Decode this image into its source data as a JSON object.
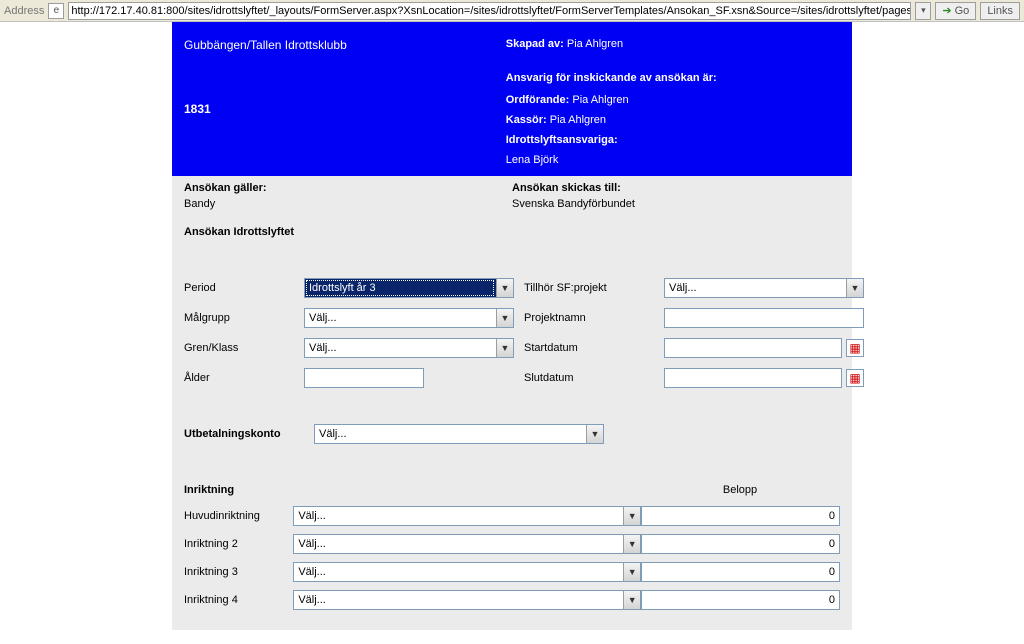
{
  "browser": {
    "address_label": "Address",
    "url": "http://172.17.40.81:800/sites/idrottslyftet/_layouts/FormServer.aspx?XsnLocation=/sites/idrottslyftet/FormServerTemplates/Ansokan_SF.xsn&Source=/sites/idrottslyftet/pages/",
    "go_label": "Go",
    "links_label": "Links",
    "favicon_glyph": "e"
  },
  "header": {
    "club_name": "Gubbängen/Tallen Idrottsklubb",
    "club_number": "1831",
    "skapad_av_label": "Skapad av:",
    "skapad_av": "Pia Ahlgren",
    "ansvarig_title": "Ansvarig för inskickande av ansökan är:",
    "ordforande_label": "Ordförande:",
    "ordforande": "Pia Ahlgren",
    "kassor_label": "Kassör:",
    "kassor": "Pia Ahlgren",
    "ansvariga_label": "Idrottslyftsansvariga:",
    "ansvariga": "Lena Björk"
  },
  "meta": {
    "ansokan_galler_label": "Ansökan gäller:",
    "ansokan_galler_value": "Bandy",
    "skickas_till_label": "Ansökan skickas till:",
    "skickas_till_value": "Svenska Bandyförbundet",
    "ansokan_title": "Ansökan Idrottslyftet"
  },
  "form": {
    "period_label": "Period",
    "period_value": "Idrottslyft år 3",
    "malgrupp_label": "Målgrupp",
    "malgrupp_value": "Välj...",
    "gren_label": "Gren/Klass",
    "gren_value": "Välj...",
    "alder_label": "Ålder",
    "alder_value": "",
    "sfprojekt_label": "Tillhör SF:projekt",
    "sfprojekt_value": "Välj...",
    "projektnamn_label": "Projektnamn",
    "projektnamn_value": "",
    "startdatum_label": "Startdatum",
    "startdatum_value": "",
    "slutdatum_label": "Slutdatum",
    "slutdatum_value": ""
  },
  "utbet": {
    "label": "Utbetalningskonto",
    "value": "Välj..."
  },
  "inriktning": {
    "heading": "Inriktning",
    "belopp_heading": "Belopp",
    "rows": [
      {
        "label": "Huvudinriktning",
        "value": "Välj...",
        "amount": "0"
      },
      {
        "label": "Inriktning 2",
        "value": "Välj...",
        "amount": "0"
      },
      {
        "label": "Inriktning 3",
        "value": "Välj...",
        "amount": "0"
      },
      {
        "label": "Inriktning 4",
        "value": "Välj...",
        "amount": "0"
      }
    ]
  }
}
